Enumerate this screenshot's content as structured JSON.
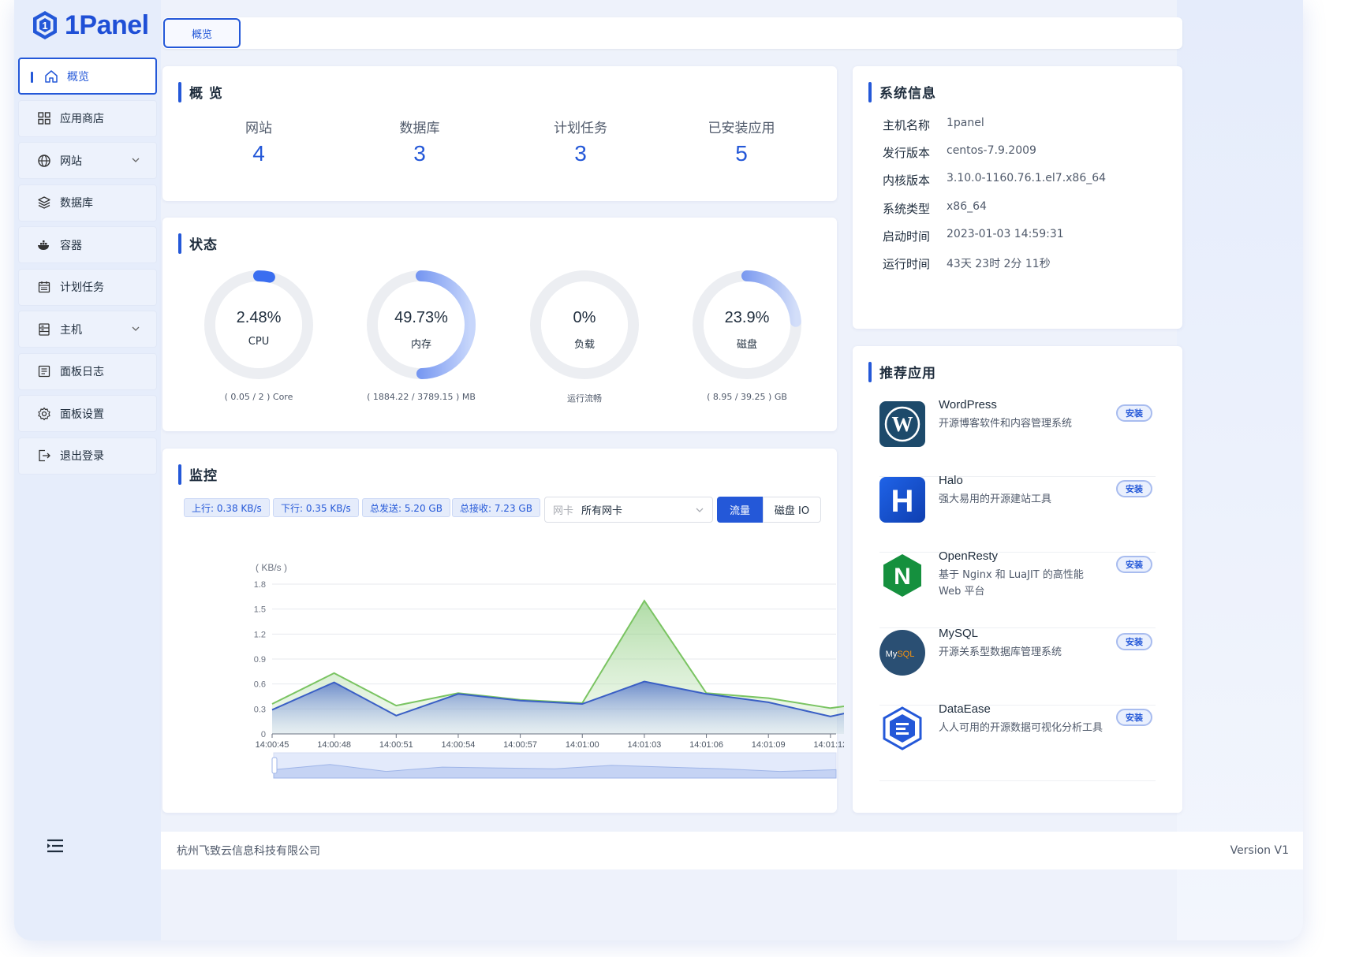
{
  "app": {
    "name": "1Panel"
  },
  "sidebar": {
    "items": [
      {
        "label": "概览",
        "icon": "home-icon"
      },
      {
        "label": "应用商店",
        "icon": "grid-icon"
      },
      {
        "label": "网站",
        "icon": "globe-icon"
      },
      {
        "label": "数据库",
        "icon": "layers-icon"
      },
      {
        "label": "容器",
        "icon": "docker-icon"
      },
      {
        "label": "计划任务",
        "icon": "calendar-icon"
      },
      {
        "label": "主机",
        "icon": "server-icon"
      },
      {
        "label": "面板日志",
        "icon": "log-icon"
      },
      {
        "label": "面板设置",
        "icon": "gear-icon"
      },
      {
        "label": "退出登录",
        "icon": "logout-icon"
      }
    ]
  },
  "tabs": [
    {
      "label": "概览"
    }
  ],
  "overview": {
    "title": "概 览",
    "items": [
      {
        "label": "网站",
        "value": "4"
      },
      {
        "label": "数据库",
        "value": "3"
      },
      {
        "label": "计划任务",
        "value": "3"
      },
      {
        "label": "已安装应用",
        "value": "5"
      }
    ]
  },
  "status": {
    "title": "状态",
    "gauges": [
      {
        "value": "2.48%",
        "label": "CPU",
        "sub": "( 0.05 / 2 ) Core",
        "percent": 2.48
      },
      {
        "value": "49.73%",
        "label": "内存",
        "sub": "( 1884.22 / 3789.15 ) MB",
        "percent": 49.73
      },
      {
        "value": "0%",
        "label": "负载",
        "sub": "运行流畅",
        "percent": 0
      },
      {
        "value": "23.9%",
        "label": "磁盘",
        "sub": "( 8.95 / 39.25 ) GB",
        "percent": 23.9
      }
    ]
  },
  "system": {
    "title": "系统信息",
    "rows": [
      {
        "key": "主机名称",
        "value": "1panel"
      },
      {
        "key": "发行版本",
        "value": "centos-7.9.2009"
      },
      {
        "key": "内核版本",
        "value": "3.10.0-1160.76.1.el7.x86_64"
      },
      {
        "key": "系统类型",
        "value": "x86_64"
      },
      {
        "key": "启动时间",
        "value": "2023-01-03 14:59:31"
      },
      {
        "key": "运行时间",
        "value": "43天 23时 2分 11秒"
      }
    ]
  },
  "apps": {
    "title": "推荐应用",
    "install_label": "安装",
    "items": [
      {
        "name": "WordPress",
        "desc": "开源博客软件和内容管理系统",
        "icon": "wordpress-icon"
      },
      {
        "name": "Halo",
        "desc": "强大易用的开源建站工具",
        "icon": "halo-icon"
      },
      {
        "name": "OpenResty",
        "desc": "基于 Nginx 和 LuaJIT 的高性能 Web 平台",
        "icon": "openresty-icon"
      },
      {
        "name": "MySQL",
        "desc": "开源关系型数据库管理系统",
        "icon": "mysql-icon"
      },
      {
        "name": "DataEase",
        "desc": "人人可用的开源数据可视化分析工具",
        "icon": "dataease-icon"
      }
    ]
  },
  "monitor": {
    "title": "监控",
    "tags": [
      "上行: 0.38 KB/s",
      "下行: 0.35 KB/s",
      "总发送: 5.20 GB",
      "总接收: 7.23 GB"
    ],
    "nic_prefix": "网卡",
    "nic_value": "所有网卡",
    "seg_on": "流量",
    "seg_off": "磁盘 IO"
  },
  "chart_data": {
    "type": "area",
    "ylabel": "( KB/s )",
    "ylim": [
      0,
      1.8
    ],
    "yticks": [
      "0",
      "0.3",
      "0.6",
      "0.9",
      "1.2",
      "1.5",
      "1.8"
    ],
    "x": [
      "14:00:45",
      "14:00:46",
      "14:00:48",
      "14:00:50",
      "14:00:51",
      "14:00:54",
      "14:00:57",
      "14:01:00",
      "14:01:03",
      "14:01:06",
      "14:01:09",
      "14:01:11",
      "14:01:12"
    ],
    "xticks": [
      "14:00:45",
      "14:00:48",
      "14:00:51",
      "14:00:54",
      "14:00:57",
      "14:01:00",
      "14:01:03",
      "14:01:06",
      "14:01:09",
      "14:01:12"
    ],
    "series": [
      {
        "values": [
          0.36,
          0.73,
          0.34,
          0.49,
          0.41,
          0.37,
          1.6,
          0.49,
          0.43,
          0.31,
          0.36
        ],
        "color": "#7ac462"
      },
      {
        "values": [
          0.29,
          0.62,
          0.22,
          0.48,
          0.4,
          0.36,
          0.63,
          0.48,
          0.38,
          0.21,
          0.29
        ],
        "color": "#3a5fc5"
      }
    ]
  },
  "footer": {
    "company": "杭州飞致云信息科技有限公司",
    "version": "Version V1"
  }
}
